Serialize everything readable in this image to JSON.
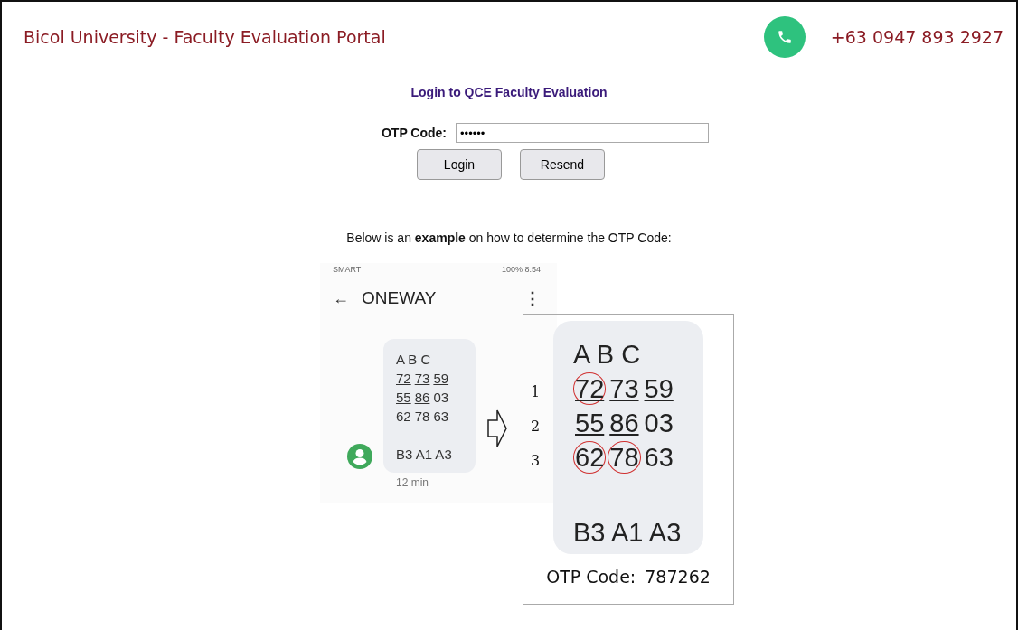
{
  "header": {
    "title": "Bicol University - Faculty Evaluation Portal",
    "phone": "+63 0947 893 2927"
  },
  "login": {
    "heading": "Login to QCE Faculty Evaluation",
    "otp_label": "OTP Code:",
    "otp_value": "••••••",
    "buttons": [
      "Login",
      "Resend"
    ]
  },
  "example_note": "Below is an **example** on how to determine the OTP Code:",
  "sms": {
    "status_left": "SMART",
    "status_right": "100%  8:54",
    "back": "←",
    "sender": "ONEWAY",
    "more": "⋮",
    "columns": "A B C",
    "rows": [
      [
        {
          "text": "72",
          "underlined": true
        },
        {
          "text": "73",
          "underlined": true
        },
        {
          "text": "59",
          "underlined": true
        }
      ],
      [
        {
          "text": "55",
          "underlined": true
        },
        {
          "text": "86",
          "underlined": true
        },
        {
          "text": "03",
          "underlined": false
        }
      ],
      [
        {
          "text": "62",
          "underlined": false
        },
        {
          "text": "78",
          "underlined": false
        },
        {
          "text": "63",
          "underlined": false
        }
      ]
    ],
    "key": "B3 A1 A3",
    "time": "12 min"
  },
  "zoom": {
    "columns": "A B C",
    "rows": [
      {
        "number": "1",
        "cells": [
          {
            "text": "72",
            "underlined": true,
            "circled": true
          },
          {
            "text": "73",
            "underlined": true,
            "circled": false
          },
          {
            "text": "59",
            "underlined": true,
            "circled": false
          }
        ]
      },
      {
        "number": "2",
        "cells": [
          {
            "text": "55",
            "underlined": true,
            "circled": false
          },
          {
            "text": "86",
            "underlined": true,
            "circled": false
          },
          {
            "text": "03",
            "underlined": false,
            "circled": false
          }
        ]
      },
      {
        "number": "3",
        "cells": [
          {
            "text": "62",
            "underlined": false,
            "circled": true
          },
          {
            "text": "78",
            "underlined": false,
            "circled": true
          },
          {
            "text": "63",
            "underlined": false,
            "circled": false
          }
        ]
      }
    ],
    "key": "B3 A1 A3",
    "result_label": "OTP Code:",
    "result_value": "787262"
  }
}
